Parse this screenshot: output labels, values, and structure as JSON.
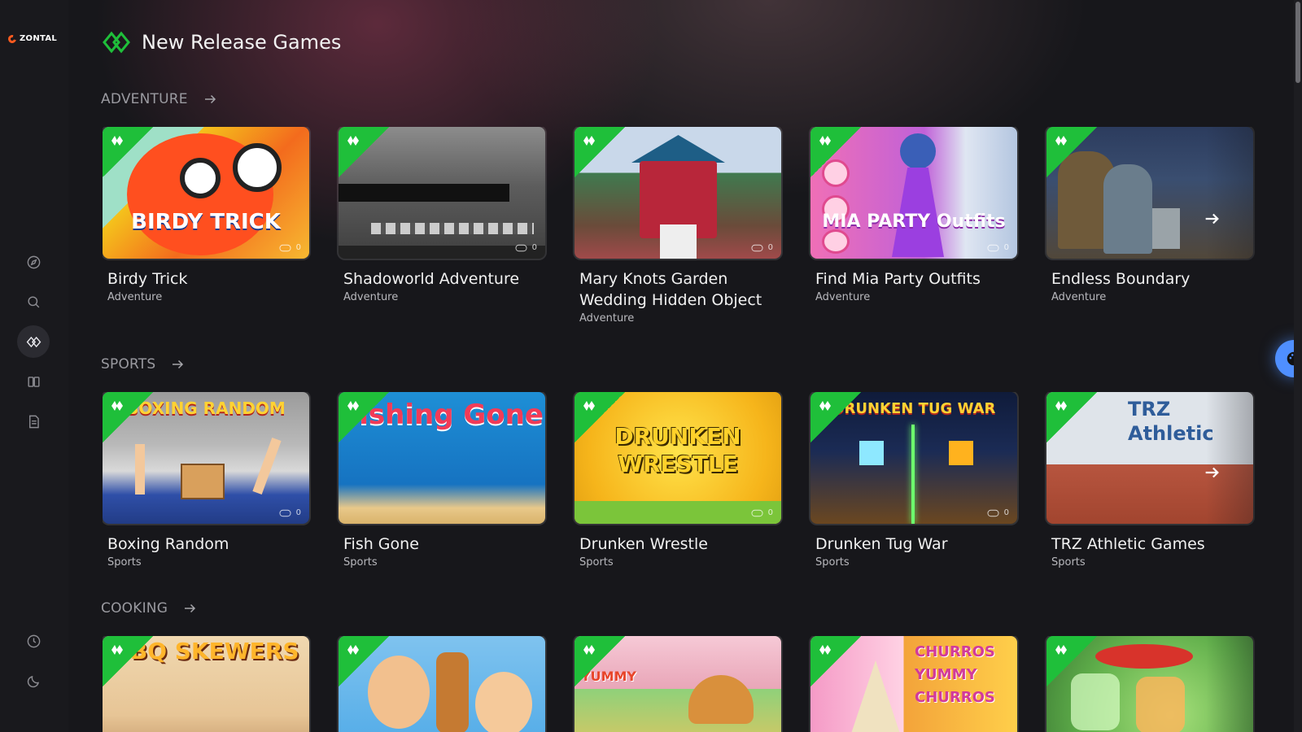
{
  "brand": {
    "name": "ZONTAL",
    "accent": "#ff5a1f"
  },
  "sidebar": {
    "items": [
      {
        "name": "explore",
        "icon": "compass-icon"
      },
      {
        "name": "search",
        "icon": "search-icon"
      },
      {
        "name": "new-releases",
        "icon": "new-release-icon",
        "active": true
      },
      {
        "name": "library",
        "icon": "book-icon"
      },
      {
        "name": "notes",
        "icon": "document-icon"
      },
      {
        "name": "history",
        "icon": "clock-icon"
      },
      {
        "name": "theme",
        "icon": "moon-icon"
      }
    ]
  },
  "page": {
    "title": "New Release Games",
    "badge_color": "#1fbf3a"
  },
  "sections": [
    {
      "title": "ADVENTURE",
      "games": [
        {
          "title": "Birdy Trick",
          "genre": "Adventure",
          "views": "0",
          "art": "BIRDY TRICK"
        },
        {
          "title": "Shadoworld Adventure",
          "genre": "Adventure",
          "views": "0",
          "art": ""
        },
        {
          "title": "Mary Knots Garden Wedding Hidden Object",
          "genre": "Adventure",
          "views": "0",
          "art": ""
        },
        {
          "title": "Find Mia Party Outfits",
          "genre": "Adventure",
          "views": "0",
          "art": "MIA PARTY Outfits"
        },
        {
          "title": "Endless Boundary",
          "genre": "Adventure",
          "views": "",
          "art": ""
        }
      ]
    },
    {
      "title": "SPORTS",
      "games": [
        {
          "title": "Boxing Random",
          "genre": "Sports",
          "views": "0",
          "art": "BOXING RANDOM"
        },
        {
          "title": "Fish Gone",
          "genre": "Sports",
          "views": "",
          "art": "Fishing Gone"
        },
        {
          "title": "Drunken Wrestle",
          "genre": "Sports",
          "views": "0",
          "art": "DRUNKEN WRESTLE"
        },
        {
          "title": "Drunken Tug War",
          "genre": "Sports",
          "views": "0",
          "art": "DRUNKEN TUG WAR"
        },
        {
          "title": "TRZ Athletic Games",
          "genre": "Sports",
          "views": "",
          "art": "TRZ Athletic"
        }
      ]
    },
    {
      "title": "COOKING",
      "games": [
        {
          "title": "",
          "genre": "",
          "views": "",
          "art": "BBQ SKEWERS"
        },
        {
          "title": "",
          "genre": "",
          "views": "",
          "art": ""
        },
        {
          "title": "",
          "genre": "",
          "views": "",
          "art": "YUMMY"
        },
        {
          "title": "",
          "genre": "",
          "views": "",
          "art": "CHURROS YUMMY CHURROS"
        },
        {
          "title": "",
          "genre": "",
          "views": "",
          "art": ""
        }
      ]
    }
  ]
}
